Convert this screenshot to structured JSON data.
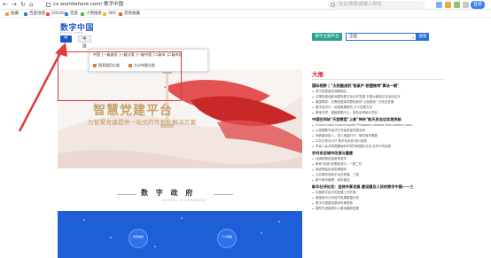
{
  "browser": {
    "url": "cx.worldwhere.com/ 数字中国",
    "search_placeholder": "在此搜索或输入网址",
    "login_label": "登录",
    "bookmarks": [
      {
        "label": "收藏",
        "color": "#f0a030"
      },
      {
        "label": "百度地图",
        "color": "#3a7de0"
      },
      {
        "label": "SOGOU",
        "color": "#e05a3a"
      },
      {
        "label": "百度",
        "color": "#3a7de0"
      },
      {
        "label": "小熊搜索",
        "color": "#5ab050"
      },
      {
        "label": "360",
        "color": "#e0c030"
      },
      {
        "label": "其他收藏",
        "color": "#e05a3a"
      }
    ]
  },
  "site": {
    "logo": "数字中国",
    "logo_sub": "DIGITAL CHINA",
    "nav_tabs": [
      "中国地图",
      "中国"
    ],
    "dig_button": "数字主题平台",
    "search_value": "全国",
    "search_button": "搜索"
  },
  "dropdown": {
    "links": [
      "中国",
      "一级省份",
      "一级分类",
      "一级中国",
      "二级市",
      "二级市区"
    ],
    "options": [
      "图表类目分类",
      "大分布图分类"
    ]
  },
  "banner": {
    "title": "智慧党建平台",
    "subtitle": "为智慧党建提供一站式的可视化解决方案"
  },
  "section": {
    "title": "数 字 政 府",
    "subtitle": "DIGITAL GOVERNMENT",
    "icons": [
      "智慧城市",
      "个人数据"
    ]
  },
  "news": {
    "heading": "大报",
    "items": [
      {
        "type": "headline",
        "text": "国际视野 | \"太阳据战机\"极紧产 欧盟推特\"算法一期\""
      },
      {
        "type": "item",
        "text": "双子座表面空间解放区"
      },
      {
        "type": "item",
        "text": "中国拟推动欧洲国际数字化合作发展 中国大使馆交流活动召开"
      },
      {
        "type": "item",
        "text": "美国联邦：无需依据事项提供新的\"认知服务\" 已完全发展"
      },
      {
        "type": "item",
        "text": "数字化时代：网络数据研究 正义发展方向"
      },
      {
        "type": "item",
        "text": "基地专项：重组数据中心：报告全球统计项目"
      },
      {
        "type": "headline",
        "text": "中国空间站\"天宫教室\"上新\"神舟\"航天员会议实现供给"
      },
      {
        "type": "item",
        "text": "China Coast Guard expels Philippine vessels from waters near..."
      },
      {
        "type": "item",
        "text": "以发展数字经济打开高质量发展空间"
      },
      {
        "type": "item",
        "text": "地铁建设投入，进入增量时代，哪些城市需要"
      },
      {
        "type": "item",
        "text": "中共中央办公厅 数字化系统 统计报告"
      },
      {
        "type": "item",
        "text": "李克人民共和国基础科学研究和国际交流 合作中华民族"
      },
      {
        "type": "headline",
        "text": "农村老旧城市改造与重建"
      },
      {
        "type": "item",
        "text": "加强和规划创新型城市"
      },
      {
        "type": "item",
        "text": "教育\"双减\"政策推进中：一周二刊"
      },
      {
        "type": "item",
        "text": "渐进提高区域发展程序"
      },
      {
        "type": "item",
        "text": "公共服务收费平台的发展、工商"
      },
      {
        "type": "item",
        "text": "新兴城市管理：城市建设"
      },
      {
        "type": "headline",
        "text": "新华社评论员：坚持共享发展 建设惠及人民的数字中国——三"
      },
      {
        "type": "item",
        "text": "实施数字经济的发展工作开展"
      },
      {
        "type": "item",
        "text": "美国各州大学经济发展数据分析"
      },
      {
        "type": "item",
        "text": "数字中国建设整体布局规划"
      },
      {
        "type": "item",
        "text": "国际先进能源中心建设最新进展"
      }
    ]
  }
}
